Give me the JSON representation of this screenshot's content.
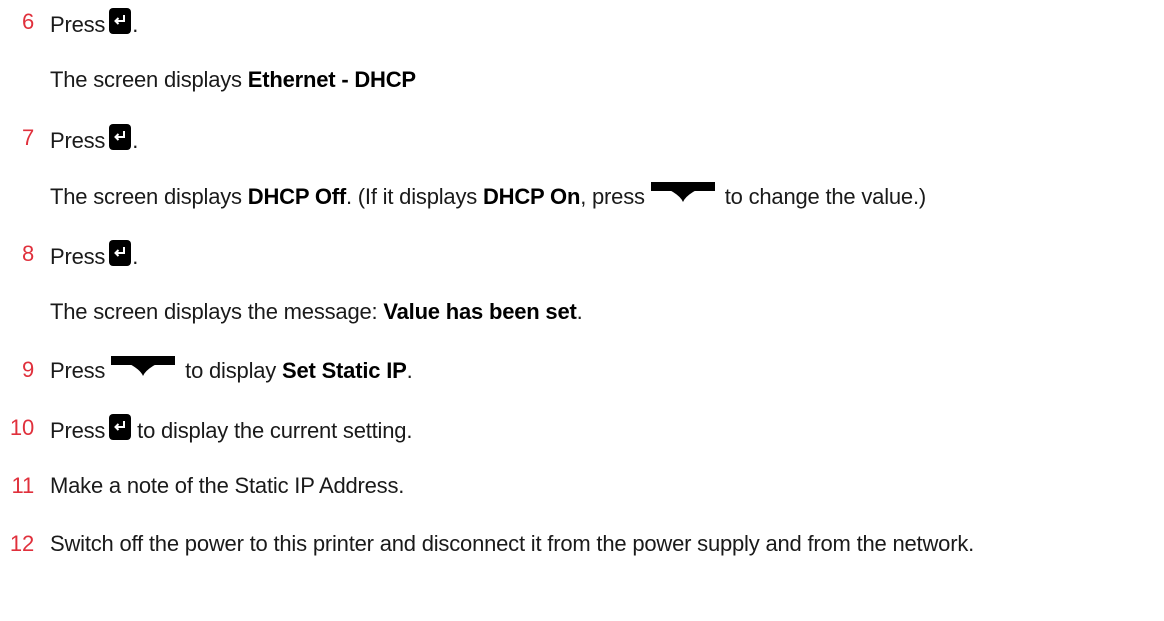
{
  "steps": [
    {
      "num": "6",
      "pre": "Press",
      "post": "."
    },
    {
      "sub_pre": "The screen displays ",
      "sub_bold": "Ethernet - DHCP"
    },
    {
      "num": "7",
      "pre": "Press",
      "post": "."
    },
    {
      "sub_pre": "The screen displays ",
      "sub_bold1": "DHCP Off",
      "sub_mid": ". (If it displays ",
      "sub_bold2": "DHCP On",
      "sub_mid2": ", press",
      "sub_post": " to change the value.)"
    },
    {
      "num": "8",
      "pre": "Press",
      "post": "."
    },
    {
      "sub_pre": "The screen displays the message: ",
      "sub_bold": "Value has been set",
      "sub_post": "."
    },
    {
      "num": "9",
      "pre": "Press",
      "mid": " to display ",
      "bold": "Set Static IP",
      "post": "."
    },
    {
      "num": "10",
      "pre": "Press",
      "post": " to display the current setting."
    },
    {
      "num": "11",
      "text": "Make a note of the Static IP Address."
    },
    {
      "num": "12",
      "text": "Switch off the power to this printer and disconnect it from the power supply and from the network."
    }
  ],
  "icons": {
    "enter": "enter-key-icon",
    "down": "down-key-icon"
  },
  "colors": {
    "step_number": "#e0303c",
    "text": "#1a1a1a"
  }
}
